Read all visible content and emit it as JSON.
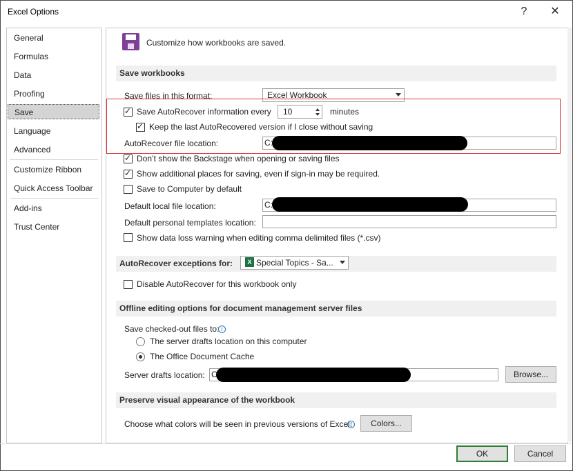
{
  "window": {
    "title": "Excel Options",
    "help": "?",
    "close": "✕"
  },
  "sidebar": {
    "items": [
      {
        "label": "General"
      },
      {
        "label": "Formulas"
      },
      {
        "label": "Data"
      },
      {
        "label": "Proofing"
      },
      {
        "label": "Save",
        "selected": true
      },
      {
        "label": "Language"
      },
      {
        "label": "Advanced"
      },
      {
        "label": "Customize Ribbon"
      },
      {
        "label": "Quick Access Toolbar"
      },
      {
        "label": "Add-ins"
      },
      {
        "label": "Trust Center"
      }
    ]
  },
  "header": {
    "title": "Customize how workbooks are saved.",
    "icon": "save-floppy-icon"
  },
  "save_workbooks": {
    "title": "Save workbooks",
    "format_label": "Save files in this format:",
    "format_value": "Excel Workbook",
    "autorecover_label": "Save AutoRecover information every",
    "autorecover_checked": true,
    "autorecover_minutes": "10",
    "minutes_label": "minutes",
    "keep_last_label": "Keep the last AutoRecovered version if I close without saving",
    "keep_last_checked": true,
    "ar_location_label": "AutoRecover file location:",
    "ar_location_value": "C:\\",
    "backstage_label": "Don’t show the Backstage when opening or saving files",
    "backstage_checked": true,
    "additional_label": "Show additional places for saving, even if sign-in may be required.",
    "additional_checked": true,
    "save_computer_label": "Save to Computer by default",
    "save_computer_checked": false,
    "default_local_label": "Default local file location:",
    "default_local_value": "C:\\",
    "templates_label": "Default personal templates location:",
    "templates_value": "",
    "data_loss_label": "Show data loss warning when editing comma delimited files (*.csv)",
    "data_loss_checked": false
  },
  "exceptions": {
    "title": "AutoRecover exceptions for:",
    "workbook": "Special Topics - Sa...",
    "disable_label": "Disable AutoRecover for this workbook only",
    "disable_checked": false
  },
  "offline": {
    "title": "Offline editing options for document management server files",
    "save_checked_out_label": "Save checked-out files to:",
    "server_drafts_label": "The server drafts location on this computer",
    "office_cache_label": "The Office Document Cache",
    "selected": "office_cache",
    "drafts_location_label": "Server drafts location:",
    "drafts_location_value": "C",
    "browse_label": "Browse..."
  },
  "preserve": {
    "title": "Preserve visual appearance of the workbook",
    "colors_label": "Choose what colors will be seen in previous versions of Excel:",
    "colors_button": "Colors..."
  },
  "footer": {
    "ok": "OK",
    "cancel": "Cancel"
  },
  "colors": {
    "highlight": "#e03030",
    "ok_border": "#2e7d32",
    "save_icon": "#7e3f98",
    "excel_icon": "#1e7145"
  }
}
